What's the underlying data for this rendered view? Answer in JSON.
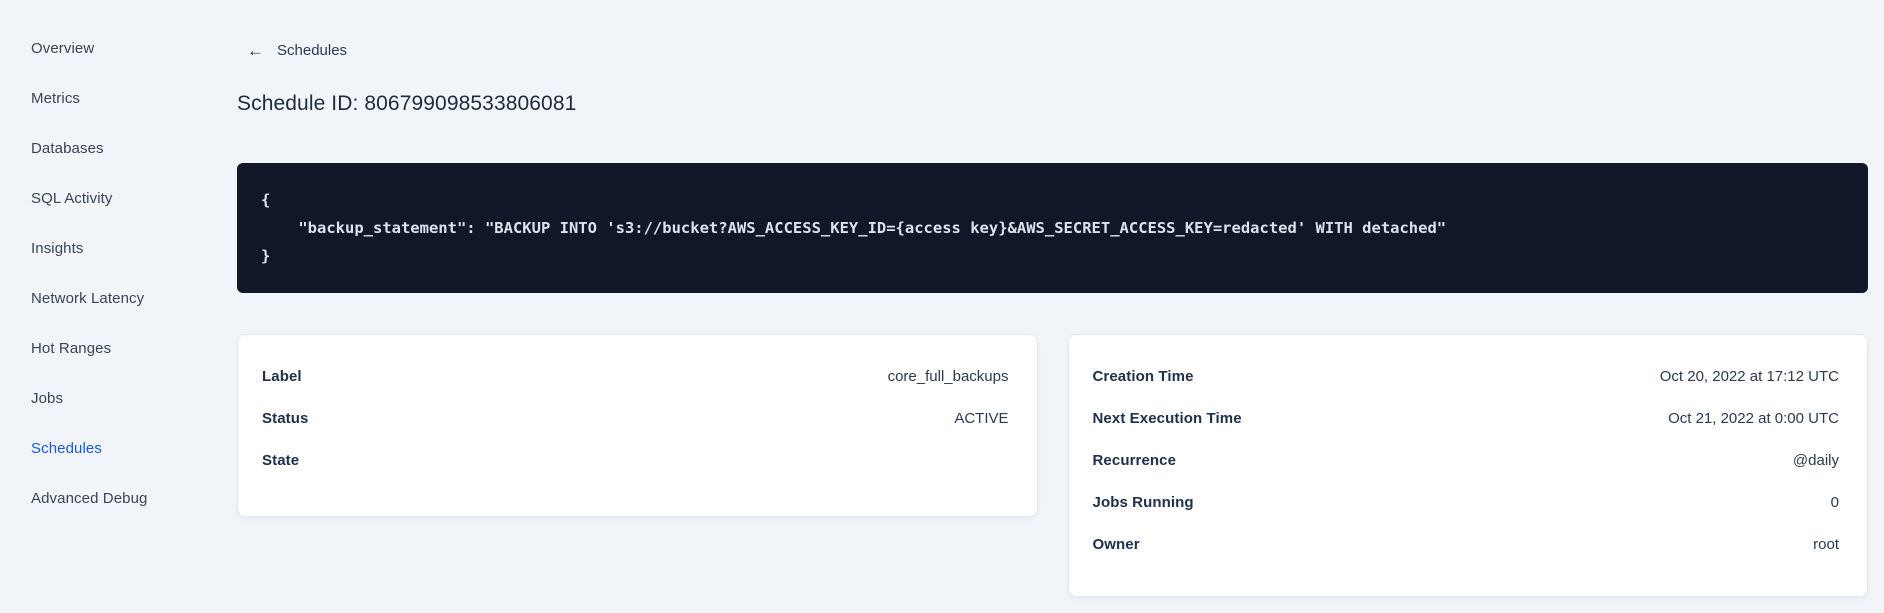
{
  "colors": {
    "page_background": "#f1f5f9",
    "code_background": "#0f1729",
    "accent_blue": "#1a56f0",
    "card_background": "#ffffff"
  },
  "sidebar": {
    "items": [
      {
        "label": "Overview",
        "active": false
      },
      {
        "label": "Metrics",
        "active": false
      },
      {
        "label": "Databases",
        "active": false
      },
      {
        "label": "SQL Activity",
        "active": false
      },
      {
        "label": "Insights",
        "active": false
      },
      {
        "label": "Network Latency",
        "active": false
      },
      {
        "label": "Hot Ranges",
        "active": false
      },
      {
        "label": "Jobs",
        "active": false
      },
      {
        "label": "Schedules",
        "active": true
      },
      {
        "label": "Advanced Debug",
        "active": false
      }
    ]
  },
  "header": {
    "back_link": {
      "icon": "arrow-left-icon",
      "glyph": "←",
      "label": "Schedules"
    },
    "title": "Schedule ID: 806799098533806081"
  },
  "schedule_definition": {
    "lines": [
      "{",
      "    \"backup_statement\": \"BACKUP INTO 's3://bucket?AWS_ACCESS_KEY_ID={access key}&AWS_SECRET_ACCESS_KEY=redacted' WITH detached\"",
      "}"
    ]
  },
  "cards": {
    "schedule": {
      "rows": [
        {
          "label": "Label",
          "value": "core_full_backups"
        },
        {
          "label": "Status",
          "value": "ACTIVE"
        },
        {
          "label": "State",
          "value": ""
        }
      ]
    },
    "execution": {
      "rows": [
        {
          "label": "Creation Time",
          "value": "Oct 20, 2022 at 17:12 UTC"
        },
        {
          "label": "Next Execution Time",
          "value": "Oct 21, 2022 at 0:00 UTC"
        },
        {
          "label": "Recurrence",
          "value": "@daily"
        },
        {
          "label": "Jobs Running",
          "value": "0"
        },
        {
          "label": "Owner",
          "value": "root"
        }
      ]
    }
  }
}
